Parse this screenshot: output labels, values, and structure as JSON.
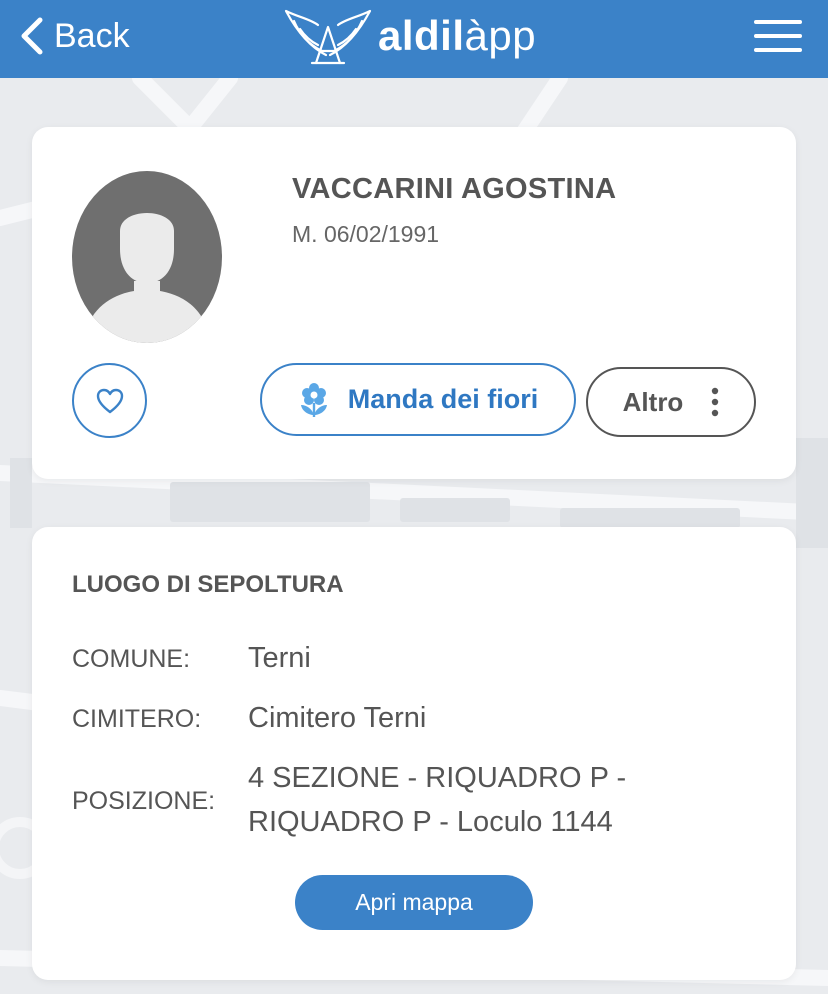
{
  "header": {
    "back_label": "Back",
    "logo_text_bold": "aldil",
    "logo_text_rest": "àpp"
  },
  "profile": {
    "name": "VACCARINI AGOSTINA",
    "death_date": "M. 06/02/1991",
    "favorite_icon": "heart-icon",
    "flowers_label": "Manda dei fiori",
    "flowers_icon": "flower-icon",
    "more_label": "Altro",
    "more_icon": "vertical-dots-icon"
  },
  "burial": {
    "title": "LUOGO DI SEPOLTURA",
    "rows": [
      {
        "label": "COMUNE:",
        "value": "Terni"
      },
      {
        "label": "CIMITERO:",
        "value": "Cimitero Terni"
      },
      {
        "label": "POSIZIONE:",
        "value_line1": "4 SEZIONE - RIQUADRO P -",
        "value_line2": "RIQUADRO P - Loculo 1144"
      }
    ],
    "map_button_label": "Apri mappa"
  },
  "colors": {
    "brand_blue": "#3b82c8",
    "text_gray": "#555555",
    "background": "#e9ebee"
  }
}
